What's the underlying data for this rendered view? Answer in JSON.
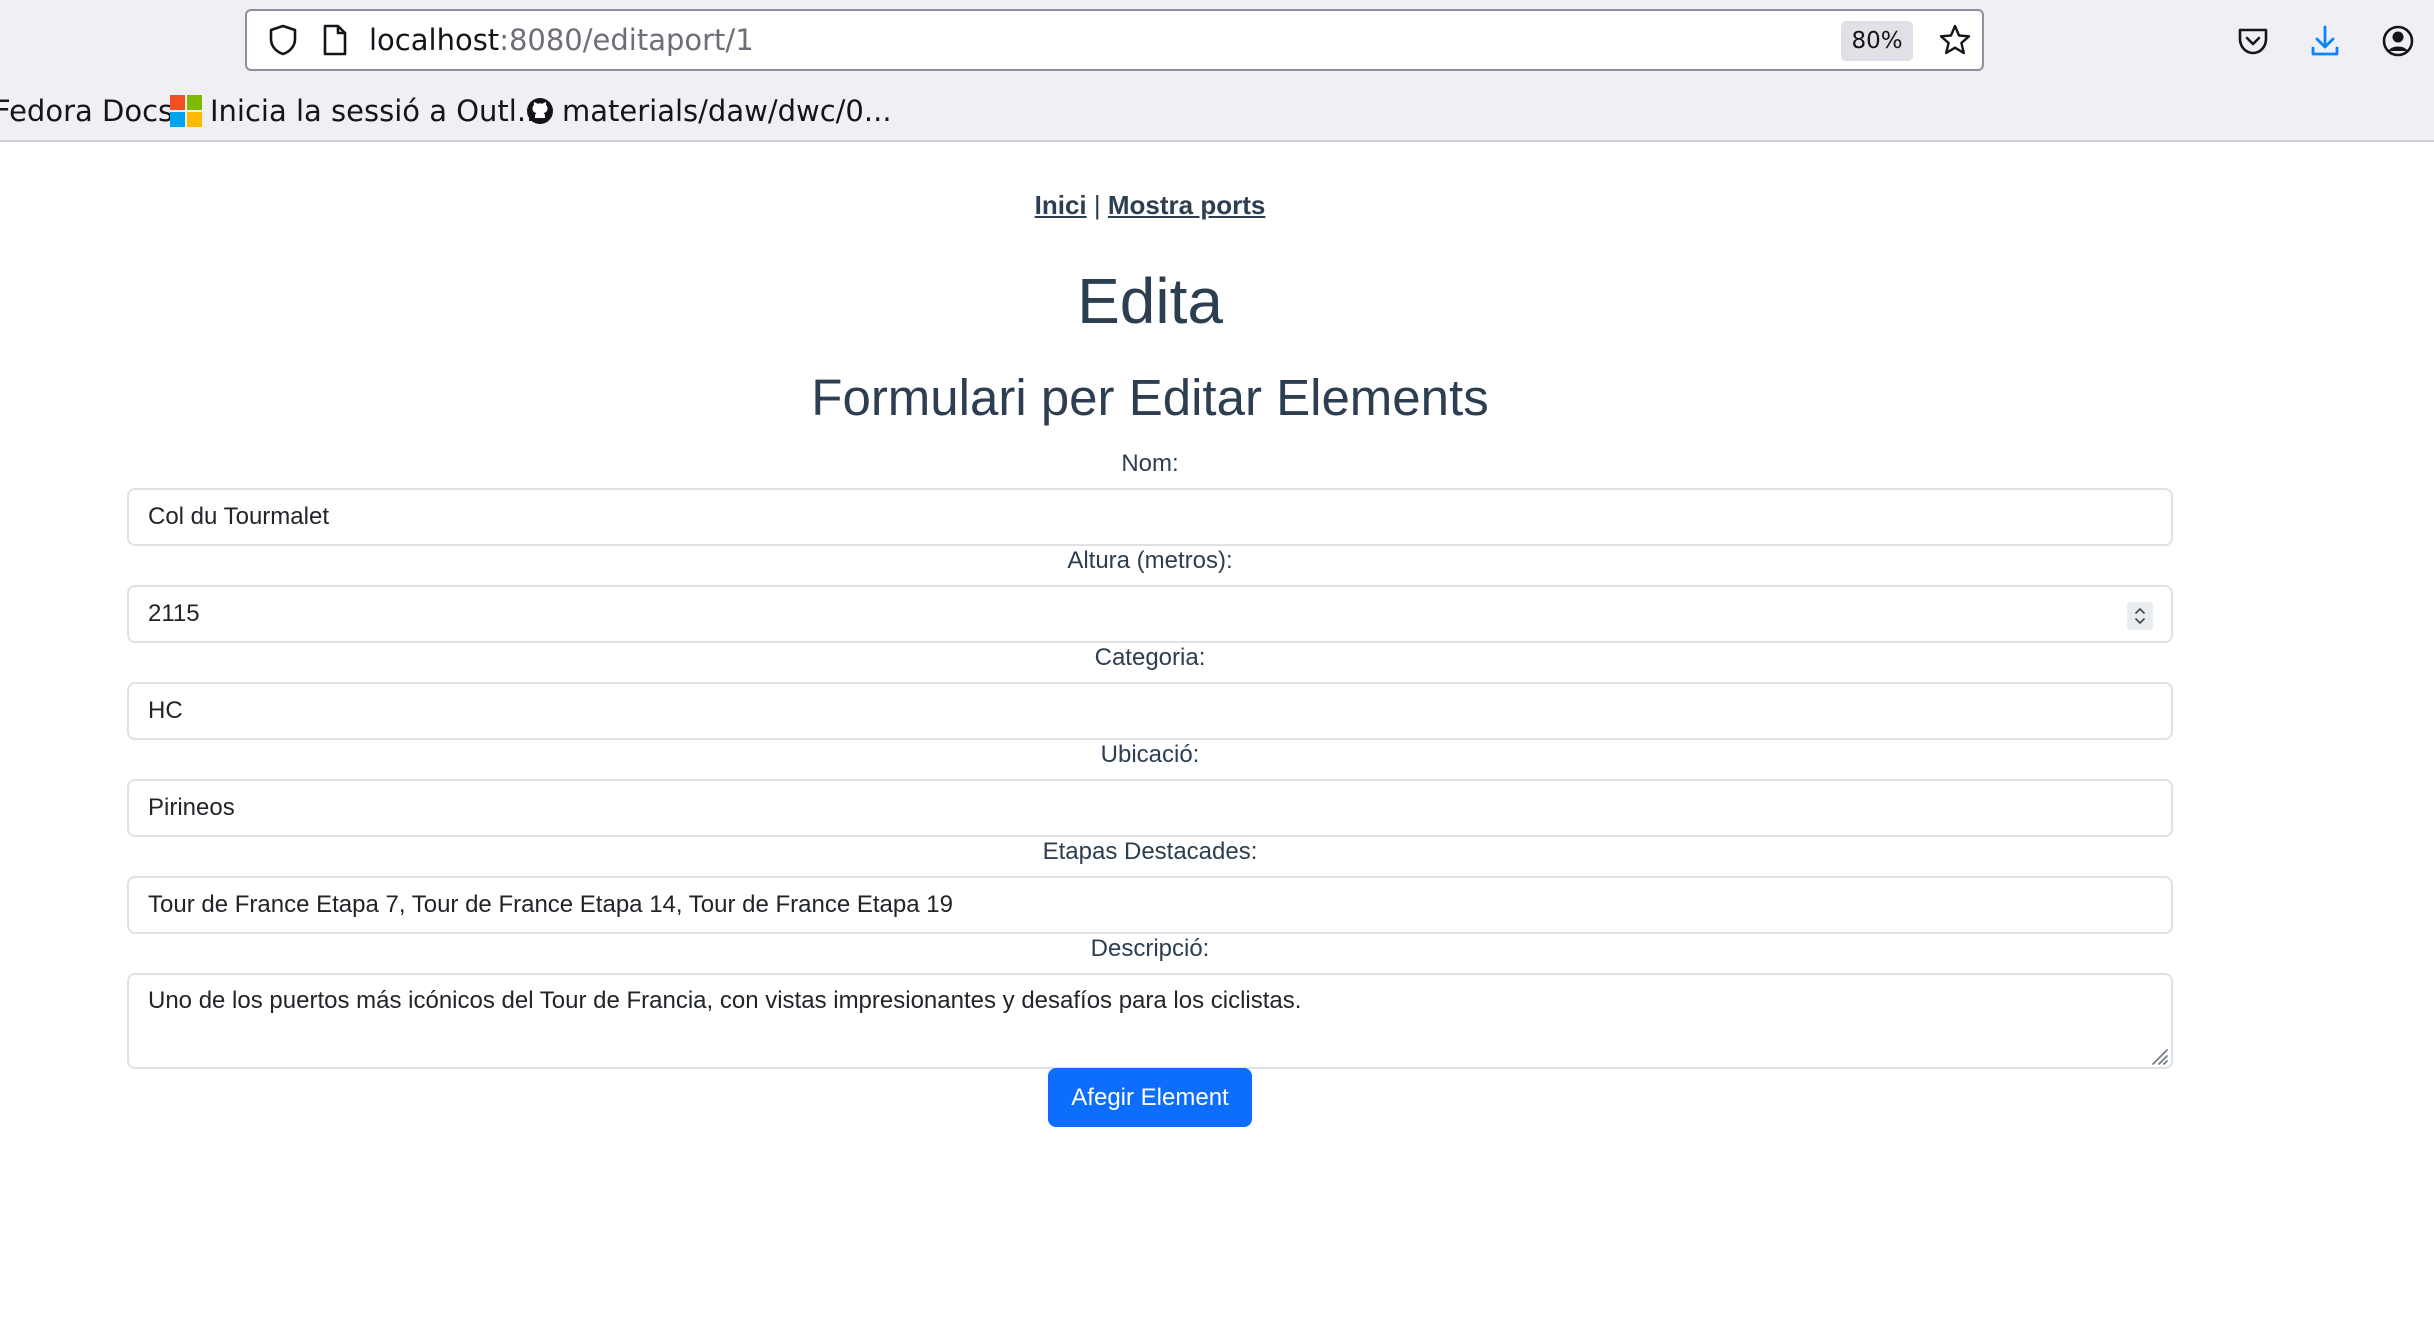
{
  "browser": {
    "url_host": "localhost",
    "url_rest": ":8080/editaport/1",
    "zoom": "80%",
    "bookmarks": [
      {
        "label": "Fedora Docs"
      },
      {
        "label": "Inicia la sessió a Outl..."
      },
      {
        "label": "materials/daw/dwc/0..."
      }
    ]
  },
  "nav": {
    "home_label": "Inici",
    "separator": "|",
    "ports_label": "Mostra ports"
  },
  "page": {
    "title": "Edita",
    "subtitle": "Formulari per Editar Elements"
  },
  "form": {
    "name_label": "Nom:",
    "name_value": "Col du Tourmalet",
    "height_label": "Altura (metros):",
    "height_value": "2115",
    "category_label": "Categoria:",
    "category_value": "HC",
    "location_label": "Ubicació:",
    "location_value": "Pirineos",
    "stages_label": "Etapas Destacades:",
    "stages_value": "Tour de France Etapa 7, Tour de France Etapa 14, Tour de France Etapa 19",
    "description_label": "Descripció:",
    "description_value": "Uno de los puertos más icónicos del Tour de Francia, con vistas impresionantes y desafíos para los ciclistas.",
    "submit_label": "Afegir Element"
  },
  "colors": {
    "heading": "#2c3e50",
    "primary_button": "#0d6efd",
    "download_icon": "#0a84ff"
  }
}
